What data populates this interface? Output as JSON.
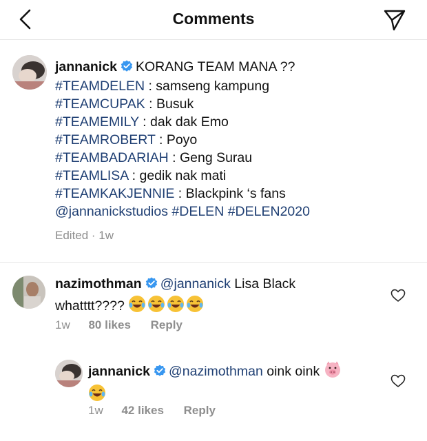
{
  "header": {
    "title": "Comments",
    "back_icon": "chevron-left-icon",
    "share_icon": "paper-plane-icon"
  },
  "caption": {
    "username": "jannanick",
    "intro": "KORANG TEAM MANA ??",
    "teams": [
      {
        "tag": "#TEAMDELEN",
        "text": " : samseng kampung"
      },
      {
        "tag": "#TEAMCUPAK",
        "text": " : Busuk"
      },
      {
        "tag": "#TEAMEMILY",
        "text": " : dak dak Emo"
      },
      {
        "tag": "#TEAMROBERT",
        "text": " : Poyo"
      },
      {
        "tag": "#TEAMBADARIAH",
        "text": " : Geng Surau"
      },
      {
        "tag": "#TEAMLISA",
        "text": " : gedik nak mati"
      },
      {
        "tag": "#TEAMKAKJENNIE",
        "text": " : Blackpink ‘s fans"
      }
    ],
    "mention": "@jannanickstudios",
    "hashtag1": "#DELEN",
    "hashtag2": "#DELEN2020",
    "meta": "Edited · 1w"
  },
  "comments": [
    {
      "username": "nazimothman",
      "mention": "@jannanick",
      "text1": " Lisa Black",
      "text2": "whatttt????",
      "emojis": [
        "face-with-tears-of-joy",
        "face-with-tears-of-joy",
        "face-with-tears-of-joy",
        "face-with-tears-of-joy"
      ],
      "time": "1w",
      "likes": "80 likes",
      "reply": "Reply"
    },
    {
      "username": "jannanick",
      "mention": "@nazimothman",
      "text1": " oink oink",
      "emoji_inline": "pig-face",
      "emojis": [
        "face-with-tears-of-joy"
      ],
      "time": "1w",
      "likes": "42 likes",
      "reply": "Reply"
    }
  ],
  "colors": {
    "link": "#1f3f73",
    "verified": "#3897f0",
    "muted": "#8e8e8e",
    "divider": "#e6e6e6"
  }
}
